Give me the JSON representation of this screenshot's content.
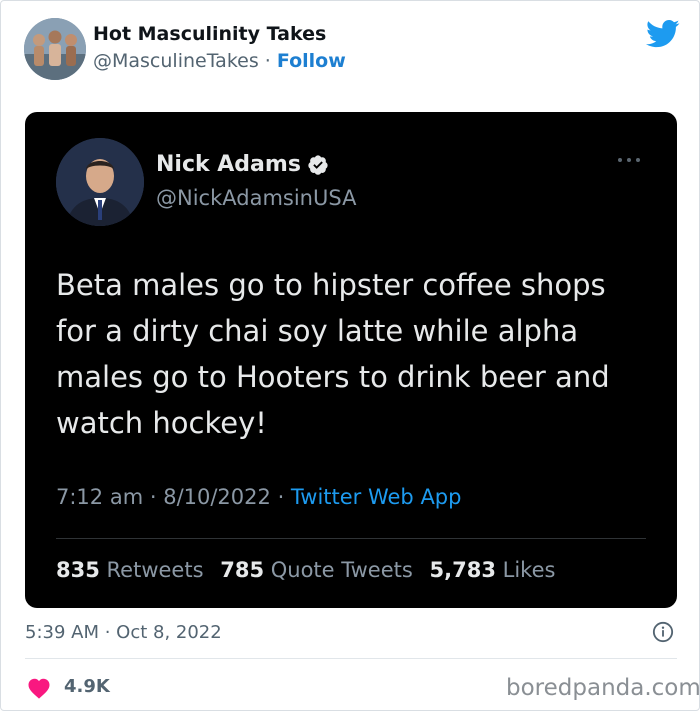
{
  "outer": {
    "name": "Hot Masculinity Takes",
    "handle": "@MasculineTakes",
    "separator": " · ",
    "follow_label": "Follow",
    "timestamp": "5:39 AM · Oct 8, 2022",
    "like_count": "4.9K",
    "watermark": "boredpanda.com"
  },
  "embedded_tweet": {
    "name": "Nick Adams",
    "handle": "@NickAdamsinUSA",
    "text": "Beta males go to hipster coffee shops\nfor a dirty chai soy latte while alpha\nmales go to Hooters to drink beer and\nwatch hockey!",
    "time": "7:12 am",
    "date": "8/10/2022",
    "dot": " · ",
    "app": "Twitter Web App",
    "stats": {
      "retweets_count": "835",
      "retweets_label": "Retweets",
      "quotes_count": "785",
      "quotes_label": "Quote Tweets",
      "likes_count": "5,783",
      "likes_label": "Likes"
    }
  },
  "icons": {
    "brand": "twitter-bird-icon",
    "verified": "verified-badge-icon",
    "more": "more-options-icon",
    "info": "info-icon",
    "like": "heart-icon"
  },
  "colors": {
    "twitter_blue": "#1d9bf0",
    "follow_blue": "#1d7fd1",
    "heart_pink": "#f91880",
    "embed_background": "#000000"
  }
}
